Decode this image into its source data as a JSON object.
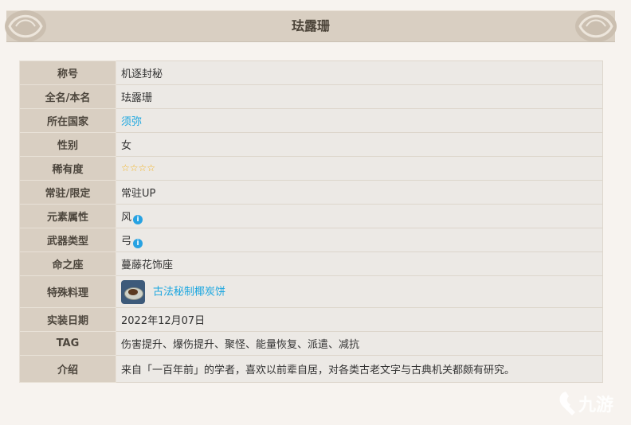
{
  "header": {
    "title": "珐露珊"
  },
  "rows": [
    {
      "label": "称号",
      "value": "机逐封秘"
    },
    {
      "label": "全名/本名",
      "value": "珐露珊"
    },
    {
      "label": "所在国家",
      "value": "须弥"
    },
    {
      "label": "性别",
      "value": "女"
    },
    {
      "label": "稀有度",
      "value": "☆☆☆☆"
    },
    {
      "label": "常驻/限定",
      "value": "常驻UP"
    },
    {
      "label": "元素属性",
      "value": "风"
    },
    {
      "label": "武器类型",
      "value": "弓"
    },
    {
      "label": "命之座",
      "value": "蔓藤花饰座"
    },
    {
      "label": "特殊料理",
      "value": "古法秘制椰炭饼"
    },
    {
      "label": "实装日期",
      "value": "2022年12月07日"
    },
    {
      "label": "TAG",
      "value": "伤害提升、爆伤提升、聚怪、能量恢复、派遣、减抗"
    },
    {
      "label": "介绍",
      "value": "来自「一百年前」的学者，喜欢以前辈自居，对各类古老文字与古典机关都颇有研究。"
    }
  ],
  "icons": {
    "info": "info-circle-icon",
    "ornament": "swirl-ornament-icon",
    "food": "coconut-charcoal-cake-icon",
    "watermark": "jiuyou-logo"
  },
  "watermark": {
    "text": "九游"
  },
  "colors": {
    "label_bg": "#d9cfc2",
    "value_bg": "#ece9e5",
    "link": "#1aa6e0",
    "star": "#f2b21f"
  }
}
